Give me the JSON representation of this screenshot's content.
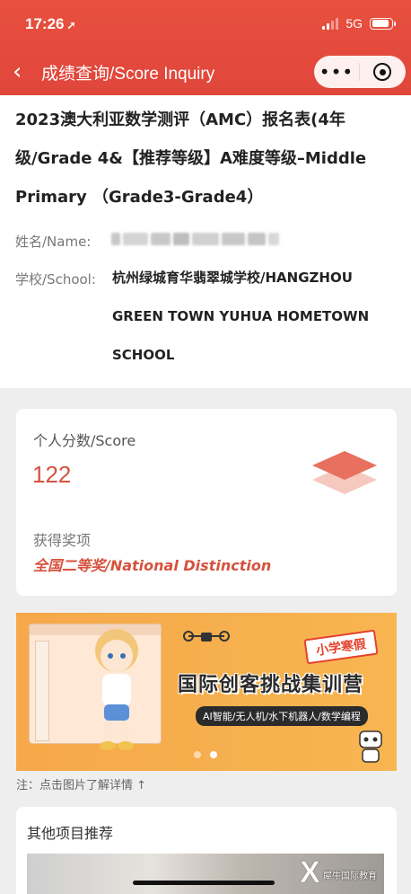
{
  "status_bar": {
    "time": "17:26",
    "network": "5G",
    "battery_level": 0.9
  },
  "nav": {
    "title": "成绩查询/Score Inquiry",
    "more_label": "•••"
  },
  "info": {
    "exam_title": "2023澳大利亚数学测评（AMC）报名表(4年级/Grade 4&【推荐等级】A难度等级–Middle Primary （Grade3-Grade4）",
    "name_label": "姓名/Name:",
    "school_label": "学校/School:",
    "school_value": "杭州绿城育华翡翠城学校/HANGZHOU GREEN TOWN YUHUA HOMETOWN SCHOOL"
  },
  "score": {
    "label": "个人分数/Score",
    "value": "122",
    "award_label": "获得奖项",
    "award_value": "全国二等奖/National Distinction"
  },
  "banner": {
    "tag": "小学寒假",
    "headline": "国际创客挑战集训营",
    "subline": "AI智能/无人机/水下机器人/数学编程",
    "active_slide": 1,
    "slide_count": 2
  },
  "note": "注：点击图片了解详情 ↑",
  "other": {
    "title": "其他项目推荐"
  },
  "watermark": {
    "text": "犀牛国际教育"
  },
  "colors": {
    "header": "#e0463a",
    "accent": "#d6523e",
    "banner": "#f6b04e"
  }
}
